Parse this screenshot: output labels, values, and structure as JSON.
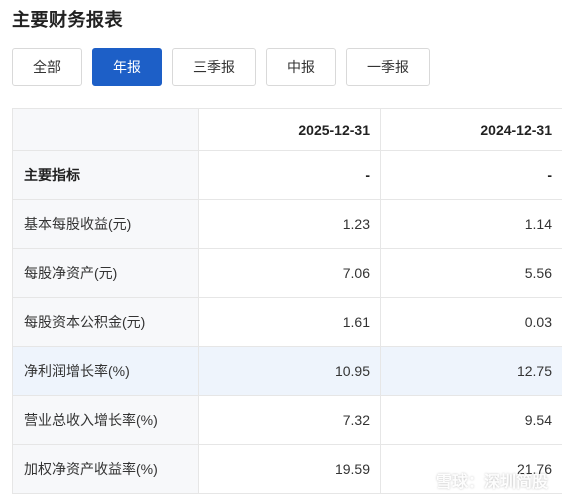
{
  "title": "主要财务报表",
  "tabs": [
    "全部",
    "年报",
    "三季报",
    "中报",
    "一季报"
  ],
  "active_tab": "年报",
  "table": {
    "columns": [
      "2025-12-31",
      "2024-12-31"
    ],
    "rows": [
      {
        "label": "主要指标",
        "values": [
          "-",
          "-"
        ]
      },
      {
        "label": "基本每股收益(元)",
        "values": [
          "1.23",
          "1.14"
        ]
      },
      {
        "label": "每股净资产(元)",
        "values": [
          "7.06",
          "5.56"
        ]
      },
      {
        "label": "每股资本公积金(元)",
        "values": [
          "1.61",
          "0.03"
        ]
      },
      {
        "label": "净利润增长率(%)",
        "values": [
          "10.95",
          "12.75"
        ]
      },
      {
        "label": "营业总收入增长率(%)",
        "values": [
          "7.32",
          "9.54"
        ]
      },
      {
        "label": "加权净资产收益率(%)",
        "values": [
          "19.59",
          "21.76"
        ]
      }
    ]
  },
  "watermark": {
    "text": "雪球：深圳简股"
  },
  "colors": {
    "accent": "#1d5fc7",
    "highlight_row": "#eef4fc",
    "label_bg": "#f7f8fa"
  }
}
